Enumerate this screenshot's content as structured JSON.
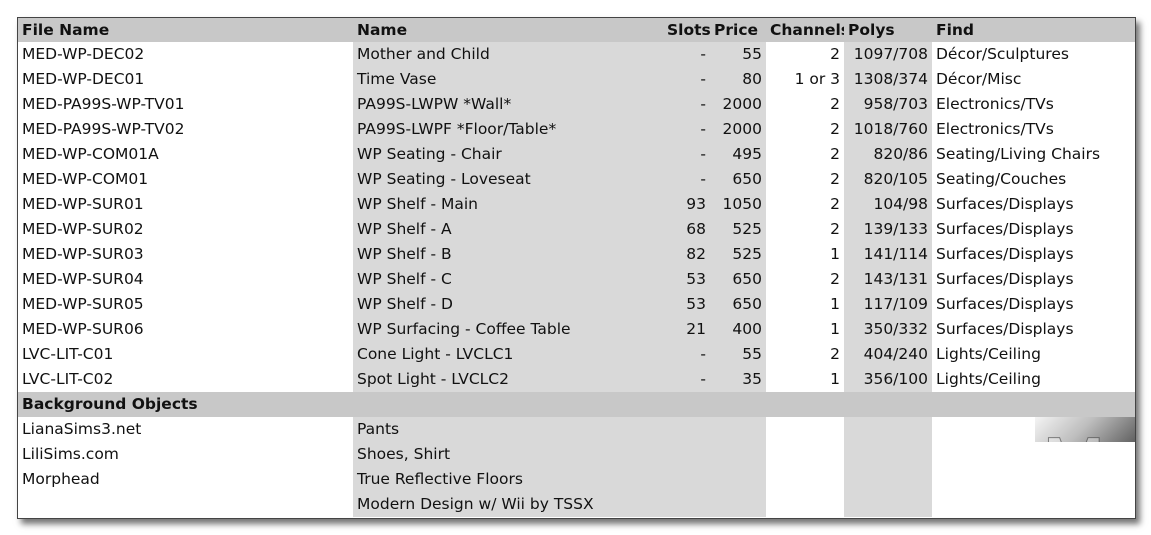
{
  "columns": [
    "File Name",
    "Name",
    "Slots",
    "Price",
    "Channels",
    "Polys",
    "Find"
  ],
  "rows": [
    {
      "file": "MED-WP-DEC02",
      "name": "Mother and Child",
      "slots": "-",
      "price": "55",
      "channels": "2",
      "polys": "1097/708",
      "find": "Décor/Sculptures"
    },
    {
      "file": "MED-WP-DEC01",
      "name": "Time Vase",
      "slots": "-",
      "price": "80",
      "channels": "1 or 3",
      "polys": "1308/374",
      "find": "Décor/Misc"
    },
    {
      "file": "MED-PA99S-WP-TV01",
      "name": "PA99S-LWPW *Wall*",
      "slots": "-",
      "price": "2000",
      "channels": "2",
      "polys": "958/703",
      "find": "Electronics/TVs"
    },
    {
      "file": "MED-PA99S-WP-TV02",
      "name": "PA99S-LWPF *Floor/Table*",
      "slots": "-",
      "price": "2000",
      "channels": "2",
      "polys": "1018/760",
      "find": "Electronics/TVs"
    },
    {
      "file": "MED-WP-COM01A",
      "name": "WP Seating - Chair",
      "slots": "-",
      "price": "495",
      "channels": "2",
      "polys": "820/86",
      "find": "Seating/Living Chairs"
    },
    {
      "file": "MED-WP-COM01",
      "name": "WP Seating - Loveseat",
      "slots": "-",
      "price": "650",
      "channels": "2",
      "polys": "820/105",
      "find": "Seating/Couches"
    },
    {
      "file": "MED-WP-SUR01",
      "name": "WP Shelf - Main",
      "slots": "93",
      "price": "1050",
      "channels": "2",
      "polys": "104/98",
      "find": "Surfaces/Displays"
    },
    {
      "file": "MED-WP-SUR02",
      "name": "WP Shelf - A",
      "slots": "68",
      "price": "525",
      "channels": "2",
      "polys": "139/133",
      "find": "Surfaces/Displays"
    },
    {
      "file": "MED-WP-SUR03",
      "name": "WP Shelf - B",
      "slots": "82",
      "price": "525",
      "channels": "1",
      "polys": "141/114",
      "find": "Surfaces/Displays"
    },
    {
      "file": "MED-WP-SUR04",
      "name": "WP Shelf - C",
      "slots": "53",
      "price": "650",
      "channels": "2",
      "polys": "143/131",
      "find": "Surfaces/Displays"
    },
    {
      "file": "MED-WP-SUR05",
      "name": "WP Shelf - D",
      "slots": "53",
      "price": "650",
      "channels": "1",
      "polys": "117/109",
      "find": "Surfaces/Displays"
    },
    {
      "file": "MED-WP-SUR06",
      "name": "WP Surfacing - Coffee Table",
      "slots": "21",
      "price": "400",
      "channels": "1",
      "polys": "350/332",
      "find": "Surfaces/Displays"
    },
    {
      "file": "LVC-LIT-C01",
      "name": "Cone Light - LVCLC1",
      "slots": "-",
      "price": "55",
      "channels": "2",
      "polys": "404/240",
      "find": "Lights/Ceiling"
    },
    {
      "file": "LVC-LIT-C02",
      "name": "Spot Light - LVCLC2",
      "slots": "-",
      "price": "35",
      "channels": "1",
      "polys": "356/100",
      "find": "Lights/Ceiling"
    }
  ],
  "section_title": "Background Objects",
  "background": [
    {
      "source": "LianaSims3.net",
      "item": "Pants"
    },
    {
      "source": "LiliSims.com",
      "item": "Shoes, Shirt"
    },
    {
      "source": "Morphead",
      "item": "True Reflective Floors"
    },
    {
      "source": "",
      "item": "Modern Design w/ Wii by TSSX"
    }
  ],
  "logo_icon": "m-logo-icon",
  "colors": {
    "header_bg": "#c8c8c8",
    "shaded_col": "#d9d9d9"
  }
}
